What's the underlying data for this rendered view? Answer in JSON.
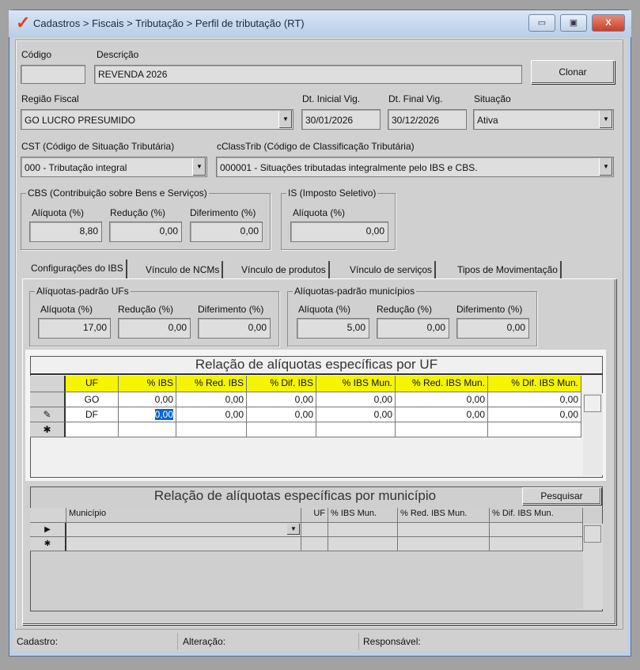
{
  "window": {
    "title": "Cadastros > Fiscais > Tributação > Perfil de tributação (RT)",
    "minimize": "▭",
    "maximize": "▣",
    "close": "X"
  },
  "form": {
    "codigo_label": "Código",
    "codigo_value": "",
    "descricao_label": "Descrição",
    "descricao_value": "REVENDA 2026",
    "clonar": "Clonar",
    "regiao_label": "Região Fiscal",
    "regiao_value": "GO LUCRO PRESUMIDO",
    "dt_inicial_label": "Dt. Inicial Vig.",
    "dt_inicial_value": "30/01/2026",
    "dt_final_label": "Dt. Final Vig.",
    "dt_final_value": "30/12/2026",
    "situacao_label": "Situação",
    "situacao_value": "Ativa",
    "cst_label": "CST (Código de Situação Tributária)",
    "cst_value": "000 - Tributação integral",
    "cclass_label": "cClassTrib (Código de Classificação Tributária)",
    "cclass_value": "000001 - Situações tributadas integralmente pelo IBS e CBS."
  },
  "cbs": {
    "title": "CBS (Contribuição sobre Bens e Serviços)",
    "aliquota_label": "Alíquota (%)",
    "aliquota": "8,80",
    "reducao_label": "Redução (%)",
    "reducao": "0,00",
    "diferimento_label": "Diferimento (%)",
    "diferimento": "0,00"
  },
  "is": {
    "title": "IS (Imposto Seletivo)",
    "aliquota_label": "Alíquota (%)",
    "aliquota": "0,00"
  },
  "tabs": [
    "Configurações do IBS",
    "Vínculo de NCMs",
    "Vínculo de produtos",
    "Vínculo de serviços",
    "Tipos de Movimentação"
  ],
  "ufs": {
    "title": "Alíquotas-padrão UFs",
    "aliquota_label": "Alíquota (%)",
    "aliquota": "17,00",
    "reducao_label": "Redução (%)",
    "reducao": "0,00",
    "diferimento_label": "Diferimento (%)",
    "diferimento": "0,00"
  },
  "municipios": {
    "title": "Alíquotas-padrão municípios",
    "aliquota_label": "Alíquota (%)",
    "aliquota": "5,00",
    "reducao_label": "Redução (%)",
    "reducao": "0,00",
    "diferimento_label": "Diferimento (%)",
    "diferimento": "0,00"
  },
  "grid_uf": {
    "title": "Relação de alíquotas específicas por UF",
    "columns": [
      "UF",
      "% IBS",
      "% Red. IBS",
      "% Dif. IBS",
      "% IBS Mun.",
      "% Red. IBS Mun.",
      "% Dif. IBS Mun."
    ],
    "rows": [
      {
        "indicator": "",
        "cells": [
          "GO",
          "0,00",
          "0,00",
          "0,00",
          "0,00",
          "0,00",
          "0,00"
        ]
      },
      {
        "indicator": "✎",
        "cells": [
          "DF",
          "0,00",
          "0,00",
          "0,00",
          "0,00",
          "0,00",
          "0,00"
        ]
      },
      {
        "indicator": "✱",
        "cells": [
          "",
          "",
          "",
          "",
          "",
          "",
          ""
        ]
      }
    ]
  },
  "grid_mun": {
    "title": "Relação de alíquotas específicas por município",
    "search": "Pesquisar",
    "columns": [
      "Município",
      "UF",
      "% IBS Mun.",
      "% Red. IBS Mun.",
      "% Dif. IBS Mun."
    ],
    "rows": [
      {
        "indicator": "▶"
      },
      {
        "indicator": "✱"
      }
    ]
  },
  "status": {
    "cadastro": "Cadastro:",
    "alteracao": "Alteração:",
    "responsavel": "Responsável:"
  }
}
